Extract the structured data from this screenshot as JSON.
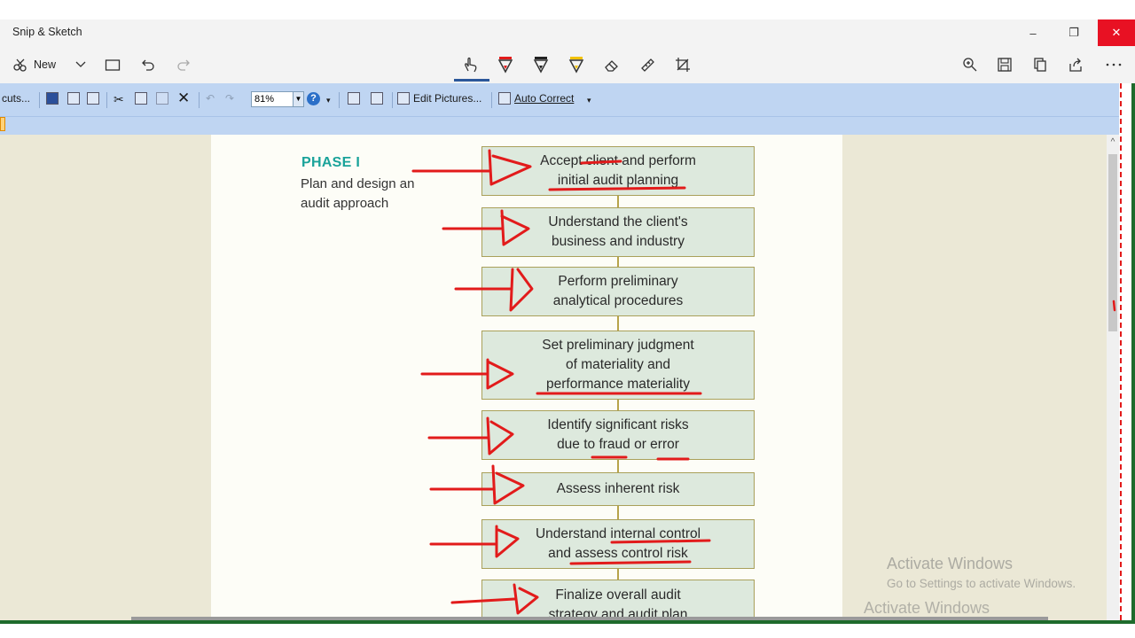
{
  "app": {
    "title": "Snip & Sketch",
    "new_label": "New"
  },
  "window_controls": {
    "minimize": "–",
    "restore": "❐",
    "close": "✕"
  },
  "office_toolbar": {
    "shortcuts_label": "cuts...",
    "zoom_value": "81%",
    "edit_pictures_label": "Edit Pictures...",
    "auto_correct_label": "Auto Correct"
  },
  "document": {
    "phase_title": "PHASE I",
    "phase_subtitle": "Plan and design an\naudit approach",
    "steps": [
      "Accept client and perform\ninitial audit planning",
      "Understand the client's\nbusiness and industry",
      "Perform preliminary\nanalytical procedures",
      "Set preliminary judgment\nof materiality and\nperformance materiality",
      "Identify significant risks\ndue to fraud or error",
      "Assess inherent risk",
      "Understand internal control\nand assess control risk",
      "Finalize overall audit\nstrategy and audit plan"
    ]
  },
  "watermark": {
    "line1": "Activate Windows",
    "line2": "Go to Settings to activate Windows.",
    "line3": "Activate Windows"
  },
  "colors": {
    "ink_red": "#e21b1b",
    "phase_teal": "#1aa39a",
    "box_fill": "#dde9dd",
    "close_red": "#e81123"
  }
}
